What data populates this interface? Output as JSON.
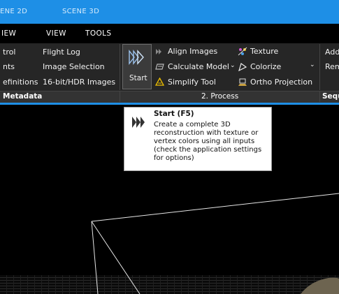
{
  "tabs": [
    {
      "label": "ENE 2D"
    },
    {
      "label": "SCENE 3D"
    }
  ],
  "menu": [
    "IEW",
    "VIEW",
    "TOOLS"
  ],
  "ribbon": {
    "metadata_col1": [
      "trol",
      "nts",
      "efinitions"
    ],
    "metadata_col2": [
      "Flight Log",
      "Image Selection",
      "16-bit/HDR Images"
    ],
    "start_label": "Start",
    "process_col1": [
      "Align Images",
      "Calculate Model",
      "Simplify Tool"
    ],
    "process_col2": [
      "Texture",
      "Colorize",
      "Ortho Projection"
    ],
    "right_col": [
      "Add",
      "Rem"
    ]
  },
  "groups": {
    "metadata": "Metadata",
    "process": "2. Process",
    "sequence": "Sequ"
  },
  "tooltip": {
    "title": "Start (F5)",
    "body": "Create a complete 3D reconstruction with texture or vertex colors using all inputs (check the application settings for options)"
  },
  "colors": {
    "accent": "#1e8fe6",
    "ribbon_bg": "#262626",
    "group_bg": "#333333"
  }
}
